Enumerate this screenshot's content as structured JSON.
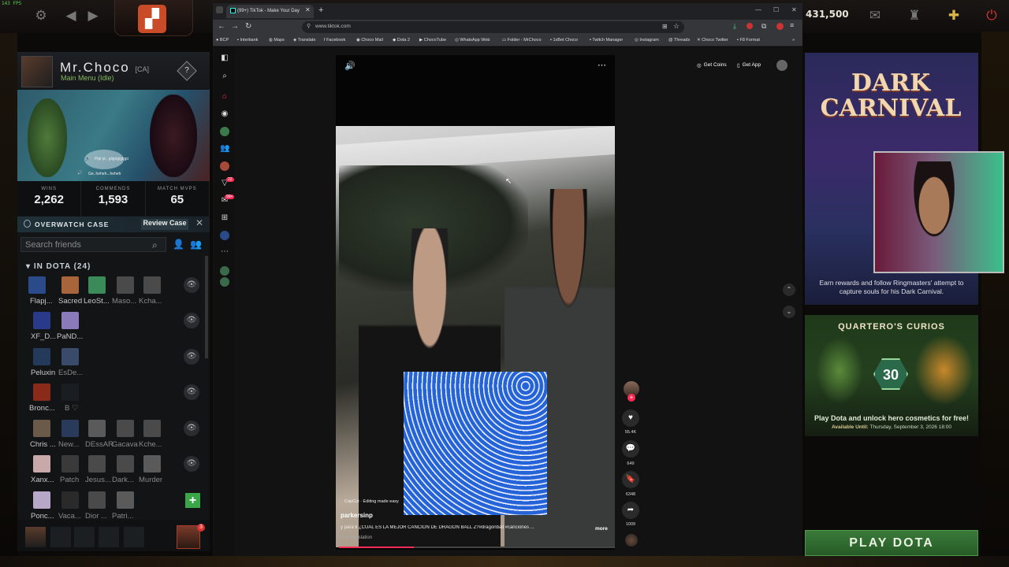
{
  "fps": "143 FPS",
  "dota": {
    "shards": "431,500",
    "profile": {
      "name": "Mr.Choco",
      "tag": "[CA]",
      "status": "Main Menu (Idle)"
    },
    "showcase_bubbles": [
      "Pipi pi , giigogigigpi",
      "Ge..heheh...heheh"
    ],
    "stats": [
      {
        "label": "WINS",
        "value": "2,262"
      },
      {
        "label": "COMMENDS",
        "value": "1,593"
      },
      {
        "label": "MATCH MVPS",
        "value": "65"
      }
    ],
    "overwatch": {
      "label": "OVERWATCH CASE",
      "button": "Review Case"
    },
    "friends_search_placeholder": "Search friends",
    "group_label": "IN DOTA (24)",
    "friend_rows": [
      [
        "Flapj...",
        "Sacred",
        "LeoSt...",
        "Maso...",
        "Kcha..."
      ],
      [
        "XF_D...",
        "PaND..."
      ],
      [
        "Peluxin",
        "EsDe..."
      ],
      [
        "Bronc...",
        "B ♡"
      ],
      [
        "Chris ...",
        "New...",
        "DEssAR",
        "Gacava",
        "Kche..."
      ],
      [
        "Xanx...",
        "Patch",
        "Jesus...",
        "Dark...",
        "Murder"
      ],
      [
        "Ponc...",
        "Vaca...",
        "Dior ...",
        "Patri..."
      ]
    ],
    "invite_badge": "3",
    "dark_carnival": {
      "title_line1": "DARK",
      "title_line2": "CARNIVAL",
      "desc": "Earn rewards and follow Ringmasters' attempt to capture souls for his Dark Carnival."
    },
    "curios": {
      "title": "QUARTERO'S CURIOS",
      "badge": "30",
      "desc": "Play Dota and unlock hero cosmetics for free!",
      "until_label": "Available Until:",
      "until_value": "Thursday, September 3, 2026 18:00"
    },
    "play_button": "PLAY DOTA"
  },
  "browser": {
    "tab_title": "(99+) TikTok - Make Your Day",
    "url": "www.tiktok.com",
    "bookmarks": [
      "BCP",
      "Interbank",
      "Maps",
      "Translate",
      "Facebook",
      "Choco Mail",
      "Dota 2",
      "ChocoTube",
      "WhatsApp Web",
      "Folder - MrChoco",
      "1xBet Choco",
      "Twitch Manager",
      "Instagram",
      "Threads",
      "Choco Twitter",
      "F8 Format"
    ]
  },
  "tiktok": {
    "get_coins": "Get Coins",
    "get_app": "Get App",
    "notif_badges": [
      "22",
      "99+"
    ],
    "capcut": "CapCut · Editing made easy",
    "username": "parkersinp",
    "caption": "y para ti ¿CUAL ES LA MEJOR CANCIÓN DE DRAGON BALL Z?#dragonball #canciones ...",
    "more": "more",
    "see_translation": "See translation",
    "likes": "55.4K",
    "comments": "649",
    "saves": "6348",
    "shares": "1009",
    "progress": 0.27
  }
}
